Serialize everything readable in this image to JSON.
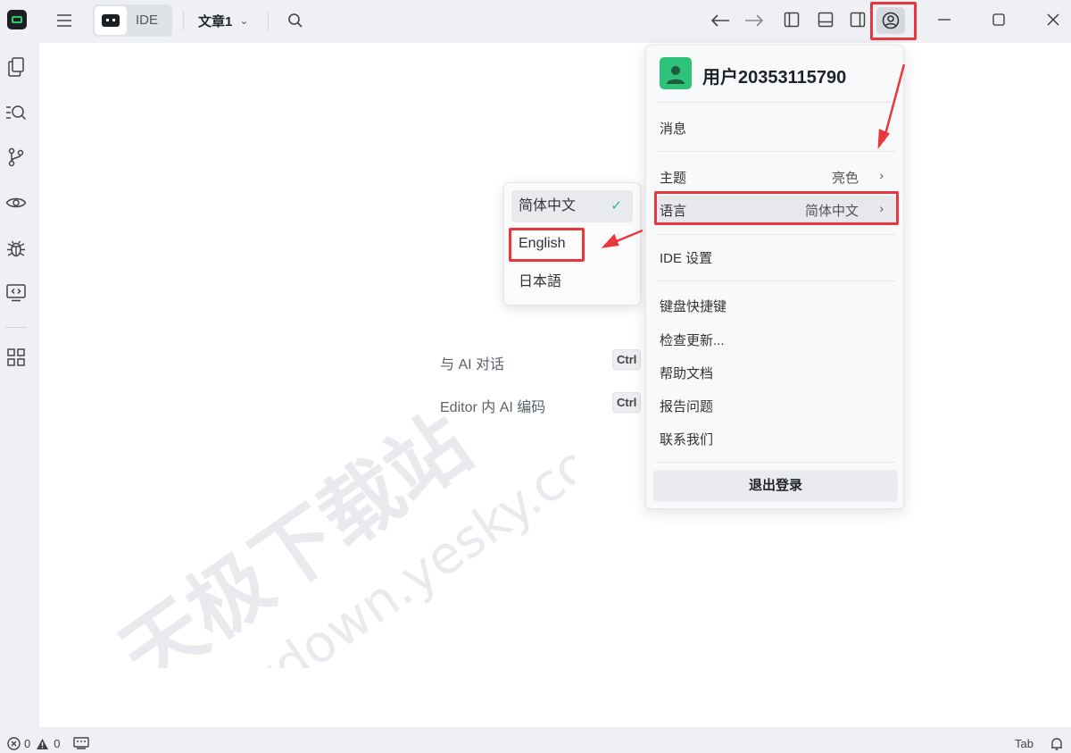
{
  "titlebar": {
    "ide_label": "IDE",
    "doc_title": "文章1",
    "icons": {
      "app": "app-logo-icon",
      "menu": "menu-icon",
      "search": "search-icon",
      "back": "arrow-left-icon",
      "forward": "arrow-right-icon",
      "user": "user-circle-icon"
    }
  },
  "editor": {
    "hints": [
      {
        "label": "与 AI 对话",
        "key": "Ctrl"
      },
      {
        "label": "Editor 内 AI 编码",
        "key": "Ctrl"
      }
    ],
    "watermark_cn": "天极下载站",
    "watermark_url": "mydown.yesky.com"
  },
  "user_menu": {
    "username": "用户20353115790",
    "messages": "消息",
    "theme_label": "主题",
    "theme_value": "亮色",
    "language_label": "语言",
    "language_value": "简体中文",
    "ide_settings": "IDE 设置",
    "shortcuts": "键盘快捷键",
    "check_updates": "检查更新...",
    "help_docs": "帮助文档",
    "report_issue": "报告问题",
    "contact_us": "联系我们",
    "logout": "退出登录"
  },
  "language_menu": {
    "options": [
      "简体中文",
      "English",
      "日本語"
    ],
    "selected": "简体中文"
  },
  "statusbar": {
    "errors": "0",
    "warnings": "0",
    "tab": "Tab"
  },
  "colors": {
    "accent_green": "#2fc27b",
    "highlight_red": "#e8383d"
  }
}
